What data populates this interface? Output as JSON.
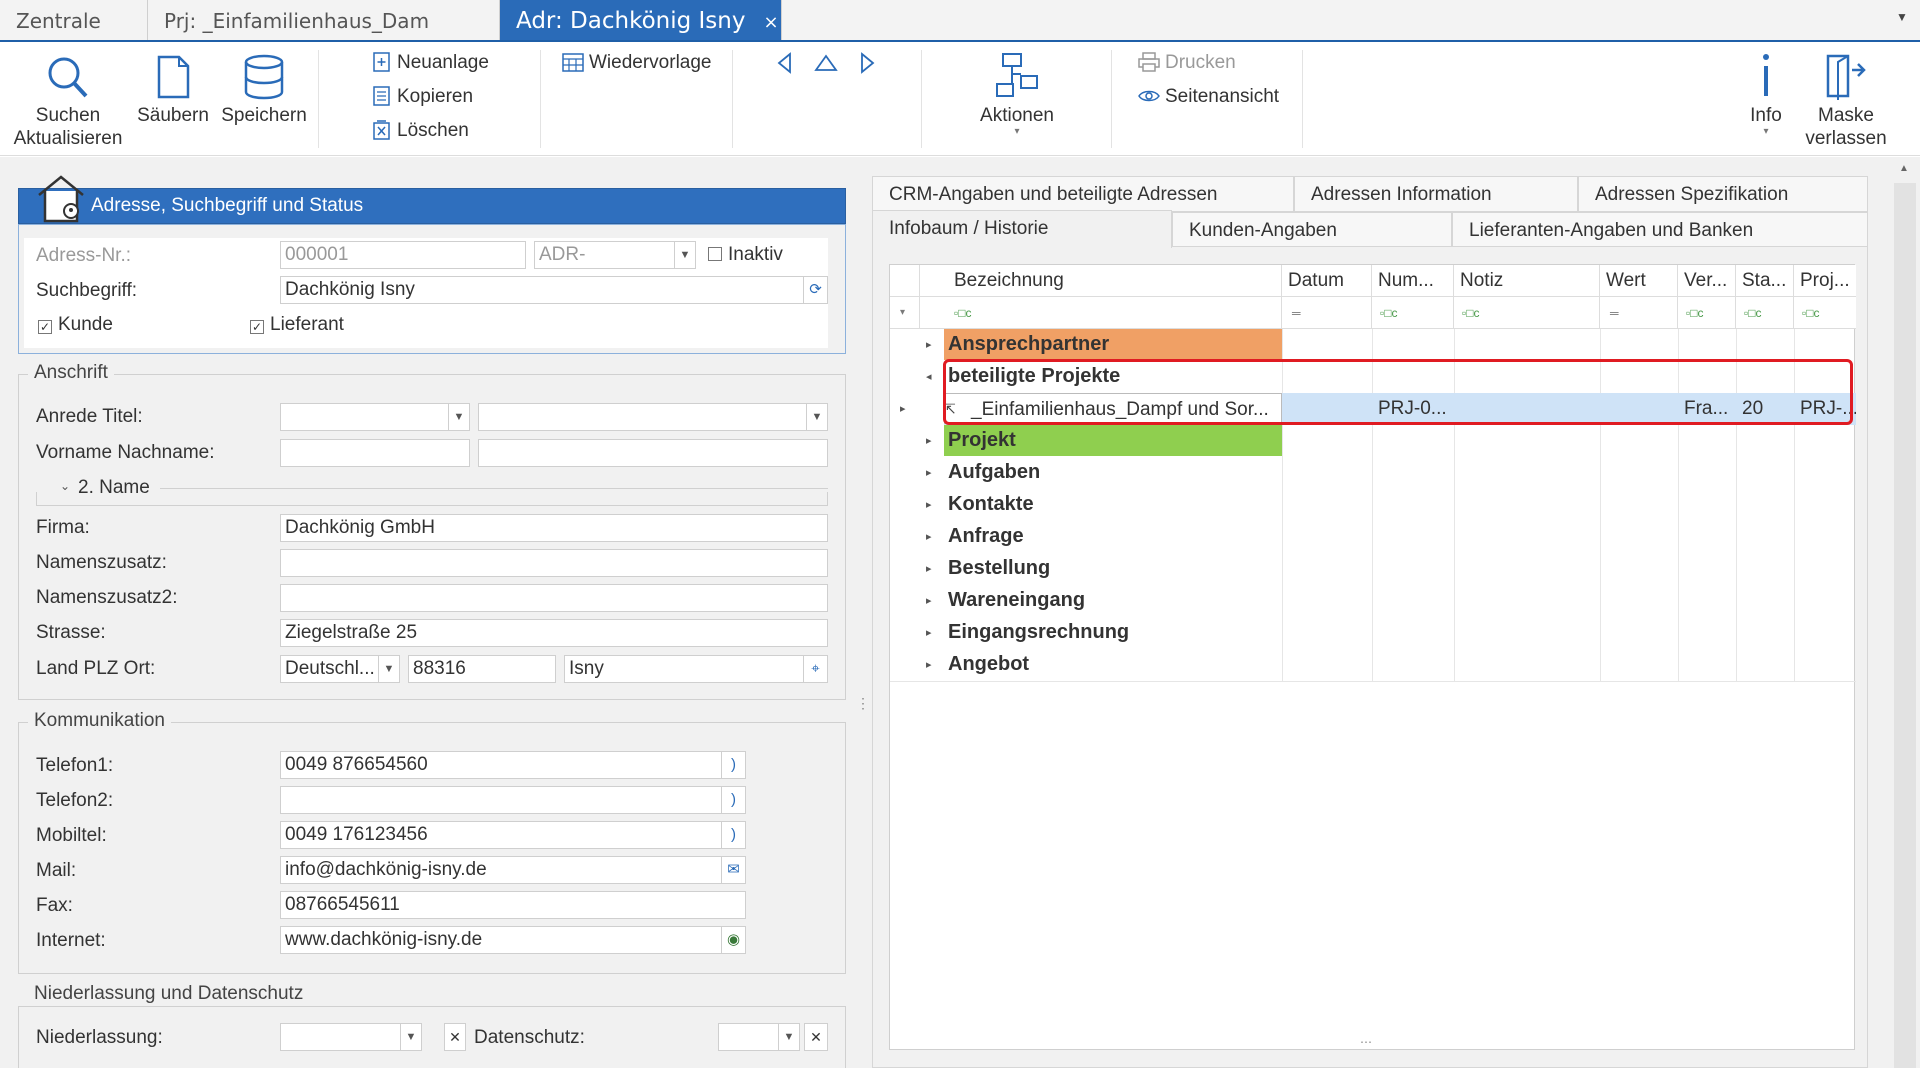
{
  "tabs": [
    {
      "label": "Zentrale"
    },
    {
      "label": "Prj: _Einfamilienhaus_Dam"
    },
    {
      "label": "Adr: Dachkönig Isny",
      "close": "×"
    }
  ],
  "ribbon": {
    "suchen": "Suchen\nAktualisieren",
    "saeubern": "Säubern",
    "speichern": "Speichern",
    "neuanlage": "Neuanlage",
    "kopieren": "Kopieren",
    "loeschen": "Löschen",
    "wiedervorlage": "Wiedervorlage",
    "aktionen": "Aktionen",
    "drucken": "Drucken",
    "seitenansicht": "Seitenansicht",
    "info": "Info",
    "maske": "Maske\nverlassen"
  },
  "address_header": {
    "title": "Adresse, Suchbegriff und Status"
  },
  "address": {
    "adress_nr_label": "Adress-Nr.:",
    "adress_nr_value": "000001",
    "adr_prefix": "ADR-",
    "inaktiv": "Inaktiv",
    "suchbegriff_label": "Suchbegriff:",
    "suchbegriff_value": "Dachkönig Isny",
    "kunde": "Kunde",
    "lieferant": "Lieferant"
  },
  "anschrift": {
    "group": "Anschrift",
    "anrede_label": "Anrede Titel:",
    "name_label": "Vorname Nachname:",
    "name2_label": "2. Name",
    "firma_label": "Firma:",
    "firma_value": "Dachkönig GmbH",
    "zusatz_label": "Namenszusatz:",
    "zusatz2_label": "Namenszusatz2:",
    "strasse_label": "Strasse:",
    "strasse_value": "Ziegelstraße 25",
    "ort_label": "Land PLZ Ort:",
    "land_value": "Deutschl...",
    "plz_value": "88316",
    "ort_value": "Isny"
  },
  "kommunikation": {
    "group": "Kommunikation",
    "telefon1_label": "Telefon1:",
    "telefon1_value": "0049 876654560",
    "telefon2_label": "Telefon2:",
    "mobil_label": "Mobiltel:",
    "mobil_value": "0049 176123456",
    "mail_label": "Mail:",
    "mail_value": "info@dachkönig-isny.de",
    "fax_label": "Fax:",
    "fax_value": "08766545611",
    "internet_label": "Internet:",
    "internet_value": "www.dachkönig-isny.de"
  },
  "niederlassung": {
    "group": "Niederlassung und Datenschutz",
    "niederlassung_label": "Niederlassung:",
    "datenschutz_label": "Datenschutz:"
  },
  "panel_tabs": {
    "crm": "CRM-Angaben und beteiligte Adressen",
    "info": "Adressen Information",
    "spez": "Adressen Spezifikation",
    "infobaum": "Infobaum / Historie",
    "kunden": "Kunden-Angaben",
    "lieferanten": "Lieferanten-Angaben und Banken"
  },
  "grid": {
    "columns": [
      "Bezeichnung",
      "Datum",
      "Num...",
      "Notiz",
      "Wert",
      "Ver...",
      "Sta...",
      "Proj..."
    ],
    "rows": [
      {
        "label": "Ansprechpartner",
        "color": "#f0a065"
      },
      {
        "label": "beteiligte Projekte"
      },
      {
        "label": "_Einfamilienhaus_Dampf und Sor...",
        "num": "PRJ-0...",
        "ver": "Fra...",
        "sta": "20",
        "proj": "PRJ-..."
      },
      {
        "label": "Projekt",
        "color": "#8fcf4f"
      },
      {
        "label": "Aufgaben"
      },
      {
        "label": "Kontakte"
      },
      {
        "label": "Anfrage"
      },
      {
        "label": "Bestellung"
      },
      {
        "label": "Wareneingang"
      },
      {
        "label": "Eingangsrechnung"
      },
      {
        "label": "Angebot"
      }
    ],
    "highlight_color": "#e01b22",
    "selected_color": "#cfe3f7"
  }
}
